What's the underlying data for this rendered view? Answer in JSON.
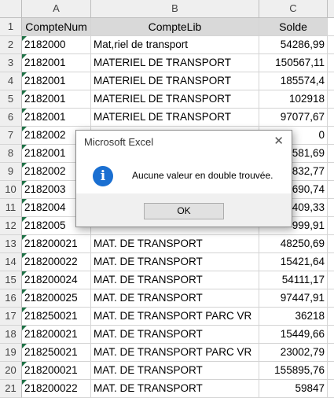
{
  "columns": [
    "A",
    "B",
    "C"
  ],
  "header_row": {
    "row_num": "1",
    "a": "CompteNum",
    "b": "CompteLib",
    "c": "Solde"
  },
  "rows": [
    {
      "num": "2",
      "a": "2182000",
      "b": "Mat,riel de transport",
      "c": "54286,99"
    },
    {
      "num": "3",
      "a": "2182001",
      "b": "MATERIEL DE TRANSPORT",
      "c": "150567,11"
    },
    {
      "num": "4",
      "a": "2182001",
      "b": "MATERIEL DE TRANSPORT",
      "c": "185574,4"
    },
    {
      "num": "5",
      "a": "2182001",
      "b": "MATERIEL DE TRANSPORT",
      "c": "102918"
    },
    {
      "num": "6",
      "a": "2182001",
      "b": "MATERIEL DE TRANSPORT",
      "c": "97077,67"
    },
    {
      "num": "7",
      "a": "2182002",
      "b": "",
      "c": "0"
    },
    {
      "num": "8",
      "a": "2182001",
      "b": "",
      "c": "581,69"
    },
    {
      "num": "9",
      "a": "2182002",
      "b": "",
      "c": "832,77"
    },
    {
      "num": "10",
      "a": "2182003",
      "b": "",
      "c": "690,74"
    },
    {
      "num": "11",
      "a": "2182004",
      "b": "",
      "c": "409,33"
    },
    {
      "num": "12",
      "a": "2182005",
      "b": "",
      "c": "999,91"
    },
    {
      "num": "13",
      "a": "218200021",
      "b": "MAT. DE TRANSPORT",
      "c": "48250,69"
    },
    {
      "num": "14",
      "a": "218200022",
      "b": "MAT. DE TRANSPORT",
      "c": "15421,64"
    },
    {
      "num": "15",
      "a": "218200024",
      "b": "MAT. DE TRANSPORT",
      "c": "54111,17"
    },
    {
      "num": "16",
      "a": "218200025",
      "b": "MAT. DE TRANSPORT",
      "c": "97447,91"
    },
    {
      "num": "17",
      "a": "218250021",
      "b": "MAT. DE TRANSPORT PARC VR",
      "c": "36218"
    },
    {
      "num": "18",
      "a": "218200021",
      "b": "MAT. DE TRANSPORT",
      "c": "15449,66"
    },
    {
      "num": "19",
      "a": "218250021",
      "b": "MAT. DE TRANSPORT PARC VR",
      "c": "23002,79"
    },
    {
      "num": "20",
      "a": "218200021",
      "b": "MAT. DE TRANSPORT",
      "c": "155895,76"
    },
    {
      "num": "21",
      "a": "218200022",
      "b": "MAT. DE TRANSPORT",
      "c": "59847"
    }
  ],
  "dialog": {
    "title": "Microsoft Excel",
    "close_glyph": "✕",
    "icon": "info-icon",
    "icon_glyph": "i",
    "message": "Aucune valeur en double trouvée.",
    "ok_label": "OK"
  },
  "colors": {
    "accent_icon": "#1a6fd1",
    "error_triangle": "#1e7145"
  }
}
